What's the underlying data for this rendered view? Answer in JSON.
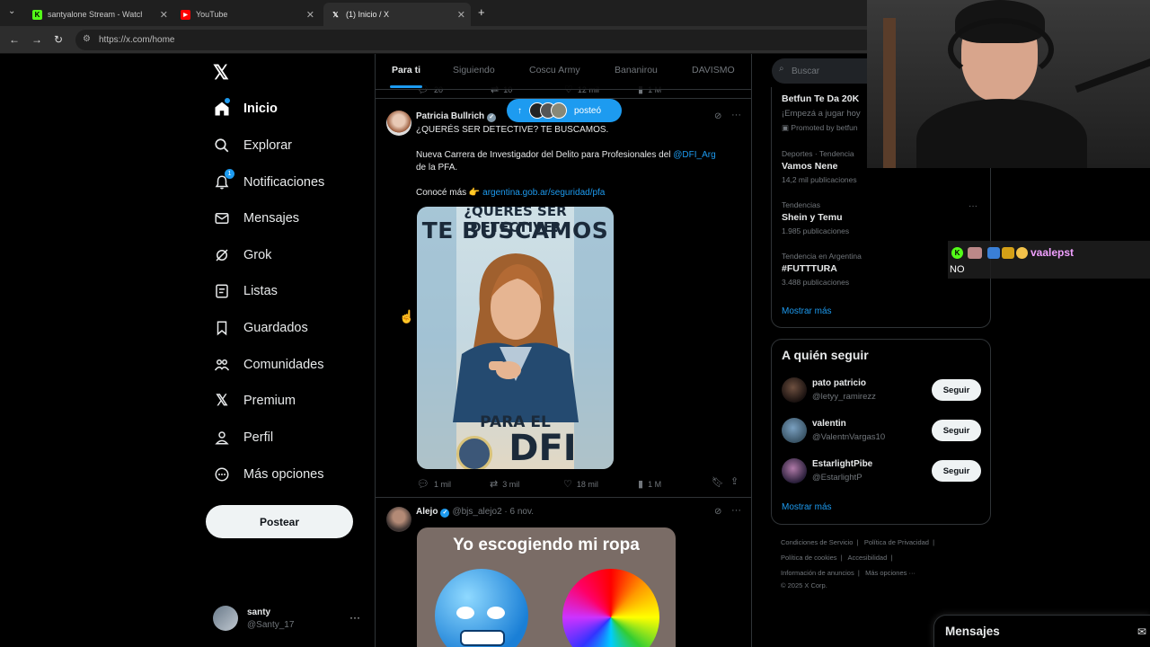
{
  "browser": {
    "tabs": [
      {
        "label": "santyalone Stream - Watch Live",
        "icon": "kick-icon",
        "color": "#53fc18"
      },
      {
        "label": "YouTube",
        "icon": "youtube-icon",
        "color": "#ff0000"
      },
      {
        "label": "(1) Inicio / X",
        "icon": "x-icon",
        "color": "#000000"
      }
    ],
    "url": "https://x.com/home"
  },
  "sidebar": {
    "items": [
      {
        "label": "Inicio",
        "icon": "home-icon"
      },
      {
        "label": "Explorar",
        "icon": "search-icon"
      },
      {
        "label": "Notificaciones",
        "icon": "bell-icon",
        "badge": "1"
      },
      {
        "label": "Mensajes",
        "icon": "mail-icon"
      },
      {
        "label": "Grok",
        "icon": "grok-icon"
      },
      {
        "label": "Listas",
        "icon": "list-icon"
      },
      {
        "label": "Guardados",
        "icon": "bookmark-icon"
      },
      {
        "label": "Comunidades",
        "icon": "communities-icon"
      },
      {
        "label": "Premium",
        "icon": "x-icon"
      },
      {
        "label": "Perfil",
        "icon": "profile-icon"
      },
      {
        "label": "Más opciones",
        "icon": "more-circle-icon"
      }
    ],
    "post_label": "Postear",
    "user": {
      "name": "santy",
      "handle": "@Santy_17"
    }
  },
  "feed": {
    "tabs": [
      "Para ti",
      "Siguiendo",
      "Coscu Army",
      "Bananirou",
      "DAVISMO"
    ],
    "prev_stats": {
      "replies": "20",
      "reposts": "10",
      "likes": "12 mil",
      "views": "1 M"
    },
    "posted_pill": "posteó",
    "tweet1": {
      "name": "Patricia Bullrich",
      "line1": "¿QUERÉS SER DETECTIVE? TE BUSCAMOS.",
      "line2a": "Nueva Carrera de Investigador del Delito para Profesionales del ",
      "line2_link": "@DFI_Arg",
      "line2b": "de la PFA.",
      "line3a": "Conocé más 👉 ",
      "line3_link": "argentina.gob.ar/seguridad/pfa",
      "image": {
        "top": "¿QUERÉS SER DETECTIVE?",
        "headline": "TE BUSCAMOS",
        "bottom1": "PARA EL",
        "bottom2": "DFI"
      },
      "stats": {
        "replies": "1 mil",
        "reposts": "3 mil",
        "likes": "18 mil",
        "views": "1 M"
      }
    },
    "tweet2": {
      "name": "Alejo",
      "meta": "@bjs_alejo2 · 6 nov.",
      "meme_title": "Yo escogiendo mi ropa"
    }
  },
  "right": {
    "search_placeholder": "Buscar",
    "trends": [
      {
        "context": "",
        "name": "Betfun Te Da 20K",
        "sub": "¡Empezá a jugar hoy",
        "promo": "Promoted by betfun"
      },
      {
        "context": "Deportes · Tendencia",
        "name": "Vamos Nene",
        "sub": "14,2 mil publicaciones"
      },
      {
        "context": "Tendencias",
        "name": "Shein y Temu",
        "sub": "1.985 publicaciones"
      },
      {
        "context": "Tendencia en Argentina",
        "name": "#FUTTTURA",
        "sub": "3.488 publicaciones"
      }
    ],
    "show_more": "Mostrar más",
    "who_to_follow": {
      "title": "A quién seguir",
      "users": [
        {
          "name": "pato patricio",
          "handle": "@letyy_ramirezz",
          "button": "Seguir"
        },
        {
          "name": "valentin",
          "handle": "@ValentnVargas10",
          "button": "Seguir"
        },
        {
          "name": "EstarlightPibe",
          "handle": "@EstarlightP",
          "button": "Seguir"
        }
      ],
      "show_more": "Mostrar más"
    },
    "footer": {
      "row1": [
        "Condiciones de Servicio",
        "Política de Privacidad"
      ],
      "row2": [
        "Política de cookies",
        "Accesibilidad"
      ],
      "row3": [
        "Información de anuncios",
        "Más opciones ···"
      ],
      "copyright": "© 2025 X Corp."
    }
  },
  "overlay": {
    "chat_user": "vaalepst",
    "chat_msg": "NO",
    "messages_label": "Mensajes"
  }
}
